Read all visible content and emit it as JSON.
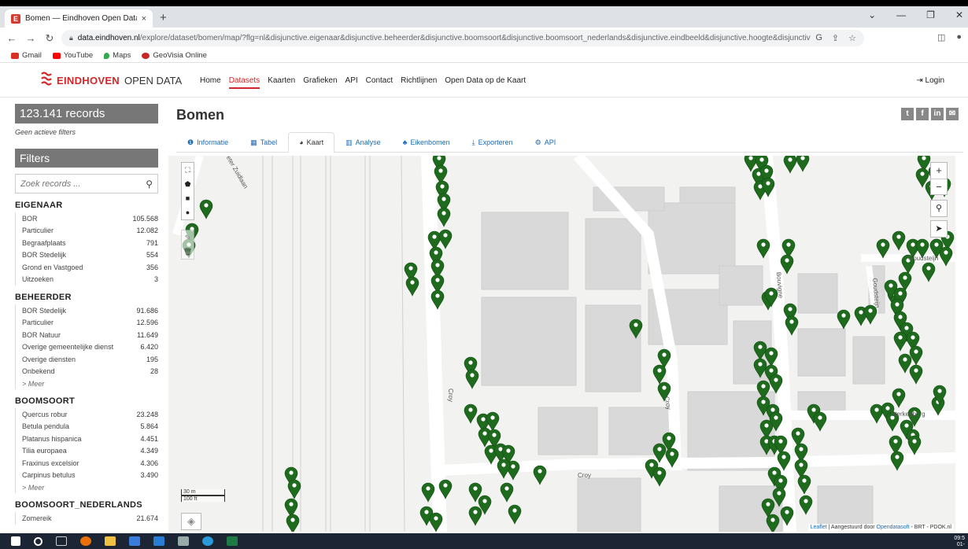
{
  "browser": {
    "tab_title": "Bomen — Eindhoven Open Data",
    "tab_close": "×",
    "new_tab": "+",
    "url_host": "data.eindhoven.nl",
    "url_path": "/explore/dataset/bomen/map/?flg=nl&disjunctive.eigenaar&disjunctive.beheerder&disjunctive.boomsoort&disjunctive.boomsoort_nederlands&disjunctive.eindbeeld&disjunctive.hoogte&disjunctive.status_ter_indicatie&disjunctive.plan...",
    "bookmarks": [
      {
        "label": "Gmail",
        "color": "#d93025"
      },
      {
        "label": "YouTube",
        "color": "#ff0000"
      },
      {
        "label": "Maps",
        "color": "#34a853"
      },
      {
        "label": "GeoVisia Online",
        "color": "#c62828"
      }
    ]
  },
  "site": {
    "brand": "EINDHOVEN",
    "brand_sub": "OPEN DATA",
    "nav": [
      "Home",
      "Datasets",
      "Kaarten",
      "Grafieken",
      "API",
      "Contact",
      "Richtlijnen",
      "Open Data op de Kaart"
    ],
    "nav_active": "Datasets",
    "login": "Login"
  },
  "sidebar": {
    "records": "123.141 records",
    "no_filters": "Geen actieve filters",
    "filters_title": "Filters",
    "search_placeholder": "Zoek records ...",
    "more_label": "> Meer",
    "facets": [
      {
        "title": "EIGENAAR",
        "items": [
          {
            "label": "BOR",
            "count": "105.568"
          },
          {
            "label": "Particulier",
            "count": "12.082"
          },
          {
            "label": "Begraafplaats",
            "count": "791"
          },
          {
            "label": "BOR Stedelijk",
            "count": "554"
          },
          {
            "label": "Grond en Vastgoed",
            "count": "356"
          },
          {
            "label": "Uitzoeken",
            "count": "3"
          }
        ],
        "more": false
      },
      {
        "title": "BEHEERDER",
        "items": [
          {
            "label": "BOR Stedelijk",
            "count": "91.686"
          },
          {
            "label": "Particulier",
            "count": "12.596"
          },
          {
            "label": "BOR Natuur",
            "count": "11.649"
          },
          {
            "label": "Overige gemeentelijke dienst",
            "count": "6.420"
          },
          {
            "label": "Overige diensten",
            "count": "195"
          },
          {
            "label": "Onbekend",
            "count": "28"
          }
        ],
        "more": true
      },
      {
        "title": "BOOMSOORT",
        "items": [
          {
            "label": "Quercus robur",
            "count": "23.248"
          },
          {
            "label": "Betula pendula",
            "count": "5.864"
          },
          {
            "label": "Platanus hispanica",
            "count": "4.451"
          },
          {
            "label": "Tilia europaea",
            "count": "4.349"
          },
          {
            "label": "Fraxinus excelsior",
            "count": "4.306"
          },
          {
            "label": "Carpinus betulus",
            "count": "3.490"
          }
        ],
        "more": true
      },
      {
        "title": "BOOMSOORT_NEDERLANDS",
        "items": [
          {
            "label": "Zomereik",
            "count": "21.674"
          }
        ],
        "more": false
      }
    ]
  },
  "main": {
    "title": "Bomen",
    "social": [
      "t",
      "f",
      "in",
      "✉"
    ],
    "tabs": [
      {
        "label": "Informatie",
        "icon": "info-icon",
        "glyph": "❶"
      },
      {
        "label": "Tabel",
        "icon": "table-icon",
        "glyph": "▦"
      },
      {
        "label": "Kaart",
        "icon": "globe-icon",
        "glyph": "◕"
      },
      {
        "label": "Analyse",
        "icon": "chart-icon",
        "glyph": "▥"
      },
      {
        "label": "Eikenbomen",
        "icon": "tree-icon",
        "glyph": "♣"
      },
      {
        "label": "Exporteren",
        "icon": "download-icon",
        "glyph": "⤓"
      },
      {
        "label": "API",
        "icon": "cogs-icon",
        "glyph": "⚙"
      }
    ],
    "active_tab": "Kaart"
  },
  "map": {
    "marker_color": "#1e6b1e",
    "streets": {
      "croy_1": "Croy",
      "croy_2": "Croy",
      "croy_3": "Croy",
      "bouvigne": "Bouvigne",
      "goudsteijn_1": "Goudsteijn",
      "goudsteijn_2": "Goudsteijn",
      "sterkenburg": "Sterkenburg",
      "peter_zuid": "Peter Zuidlaan"
    },
    "scale_m": "30 m",
    "scale_ft": "100 ft",
    "attribution_link": "Leaflet",
    "attribution_text": "| Aangestuurd door",
    "attribution_link2": "Opendatasoft",
    "attribution_tail": "- BRT - PDOK.nl"
  },
  "taskbar": {
    "time": "09:5",
    "date": "01-"
  }
}
